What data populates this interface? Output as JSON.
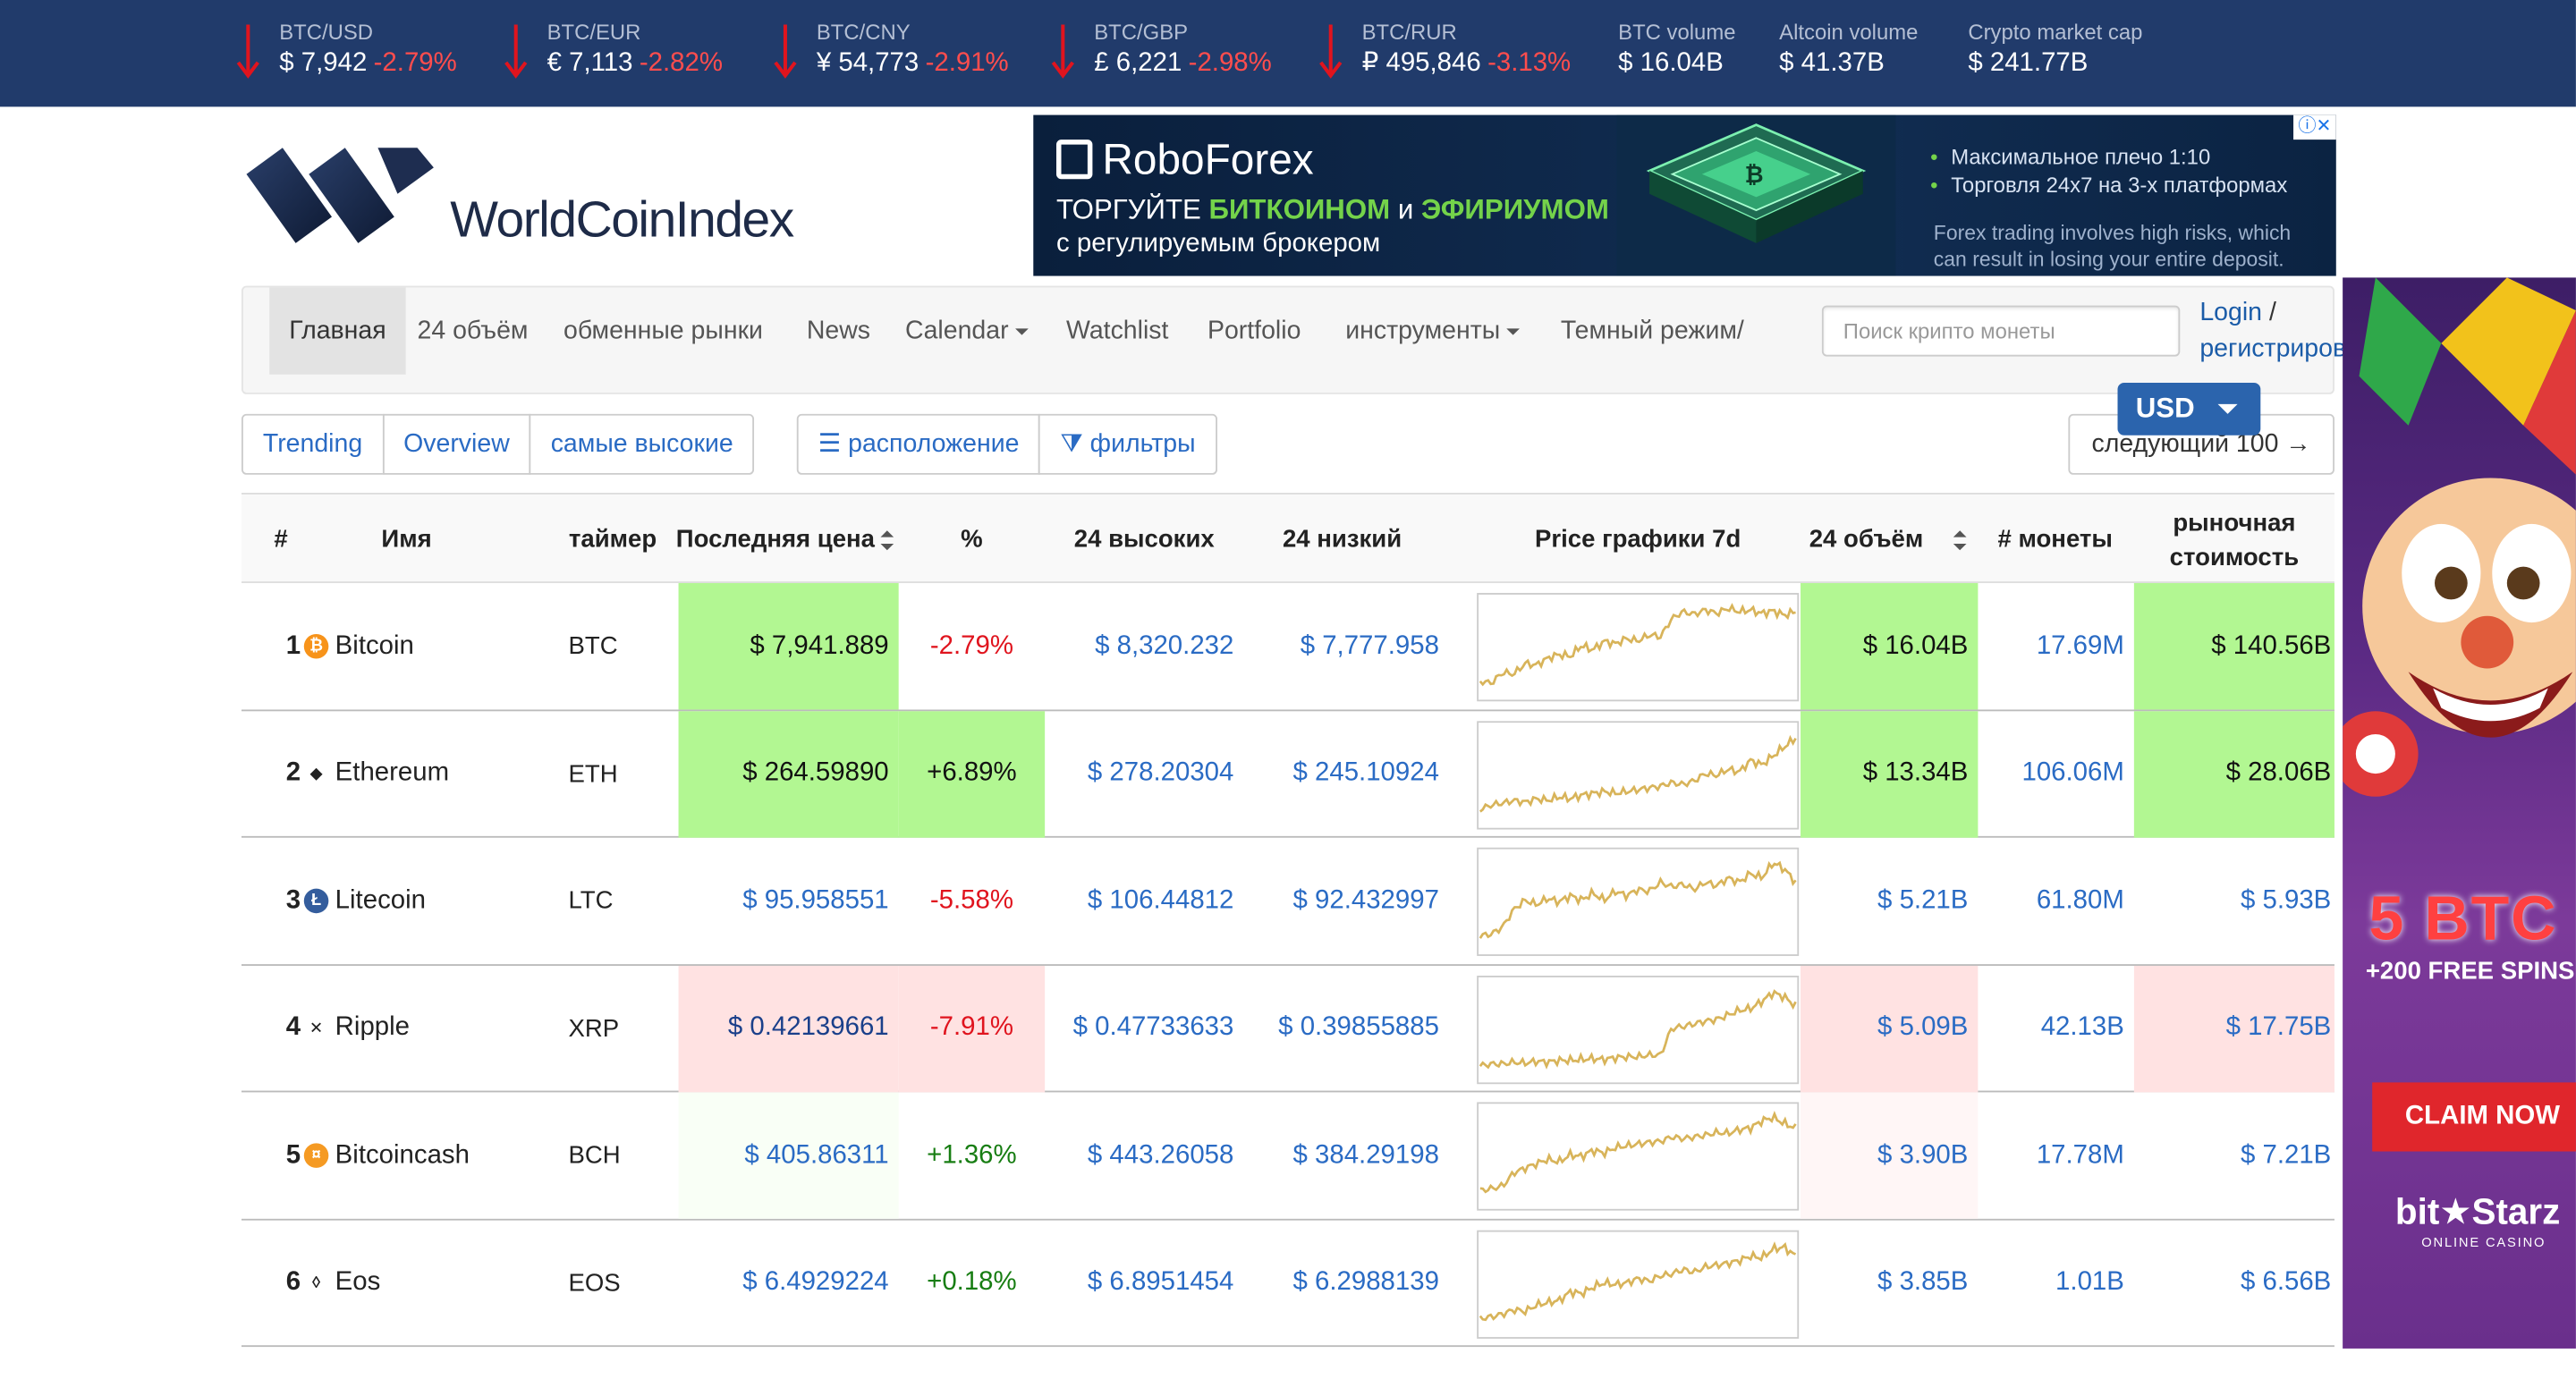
{
  "ticker": [
    {
      "label": "BTC/USD",
      "value": "$ 7,942",
      "change": "-2.79%",
      "arrow": true
    },
    {
      "label": "BTC/EUR",
      "value": "€ 7,113",
      "change": "-2.82%",
      "arrow": true
    },
    {
      "label": "BTC/CNY",
      "value": "¥ 54,773",
      "change": "-2.91%",
      "arrow": true
    },
    {
      "label": "BTC/GBP",
      "value": "£ 6,221",
      "change": "-2.98%",
      "arrow": true
    },
    {
      "label": "BTC/RUR",
      "value": "₽ 495,846",
      "change": "-3.13%",
      "arrow": true
    },
    {
      "label": "BTC volume",
      "value": "$ 16.04B",
      "change": "",
      "arrow": false
    },
    {
      "label": "Altcoin volume",
      "value": "$ 41.37B",
      "change": "",
      "arrow": false
    },
    {
      "label": "Crypto market cap",
      "value": "$ 241.77B",
      "change": "",
      "arrow": false
    }
  ],
  "logo": {
    "text": "WorldCoinIndex"
  },
  "top_ad": {
    "brand": "RoboForex",
    "line2_pre": "ТОРГУЙТЕ ",
    "line2_b1": "БИТКОИНОМ",
    "line2_mid": " и ",
    "line2_b2": "ЭФИРИУМОМ",
    "line3": "с регулируемым брокером",
    "bullet1": "Максимальное плечо 1:10",
    "bullet2": "Торговля 24x7 на 3-х платформах",
    "disclaimer1": "Forex trading involves high risks, which",
    "disclaimer2": "can result in losing your entire deposit."
  },
  "nav": {
    "items": [
      "Главная",
      "24 объём",
      "обменные рынки",
      "News",
      "Calendar",
      "Watchlist",
      "Portfolio",
      "инструменты",
      "Темный режим/"
    ],
    "search_placeholder": "Поиск крипто монеты",
    "login": "Login",
    "slash": "/",
    "register": "регистрировать"
  },
  "currency": "USD",
  "tabs": {
    "trending": "Trending",
    "overview": "Overview",
    "highest": "самые высокие"
  },
  "tools": {
    "layout": "расположение",
    "filters": "фильтры"
  },
  "next_button": "следующий 100 →",
  "table": {
    "headers": {
      "rank": "#",
      "name": "Имя",
      "ticker": "таймер",
      "price": "Последняя цена",
      "pct": "%",
      "high": "24 высоких",
      "low": "24 низкий",
      "chart": "Price графики 7d",
      "volume": "24 объём",
      "coins": "# монеты",
      "mcap1": "рыночная",
      "mcap2": "стоимость"
    },
    "rows": [
      {
        "rank": "1",
        "name": "Bitcoin",
        "ticker": "BTC",
        "price": "$ 7,941.889",
        "pct": "-2.79%",
        "high": "$ 8,320.232",
        "low": "$ 7,777.958",
        "volume": "$ 16.04B",
        "coins": "17.69M",
        "mcap": "$ 140.56B",
        "dir": "down",
        "hl": "green",
        "series": [
          0.9,
          0.92,
          0.8,
          0.82,
          0.7,
          0.72,
          0.64,
          0.6,
          0.62,
          0.5,
          0.55,
          0.45,
          0.48,
          0.42,
          0.45,
          0.38,
          0.4,
          0.2,
          0.12,
          0.15,
          0.1,
          0.14,
          0.08,
          0.12,
          0.1,
          0.14,
          0.11,
          0.16,
          0.12
        ]
      },
      {
        "rank": "2",
        "name": "Ethereum",
        "ticker": "ETH",
        "price": "$ 264.59890",
        "pct": "+6.89%",
        "high": "$ 278.20304",
        "low": "$ 245.10924",
        "volume": "$ 13.34B",
        "coins": "106.06M",
        "mcap": "$ 28.06B",
        "dir": "up",
        "hl": "green",
        "series": [
          0.9,
          0.85,
          0.83,
          0.8,
          0.82,
          0.78,
          0.8,
          0.76,
          0.78,
          0.74,
          0.72,
          0.7,
          0.72,
          0.7,
          0.68,
          0.66,
          0.64,
          0.6,
          0.62,
          0.58,
          0.5,
          0.52,
          0.45,
          0.48,
          0.35,
          0.4,
          0.3,
          0.2,
          0.1
        ]
      },
      {
        "rank": "3",
        "name": "Litecoin",
        "ticker": "LTC",
        "price": "$ 95.958551",
        "pct": "-5.58%",
        "high": "$ 106.44812",
        "low": "$ 92.432997",
        "volume": "$ 5.21B",
        "coins": "61.80M",
        "mcap": "$ 5.93B",
        "dir": "down",
        "hl": "none",
        "series": [
          0.9,
          0.88,
          0.8,
          0.6,
          0.5,
          0.55,
          0.48,
          0.52,
          0.45,
          0.5,
          0.42,
          0.5,
          0.4,
          0.45,
          0.38,
          0.4,
          0.3,
          0.35,
          0.32,
          0.38,
          0.3,
          0.34,
          0.25,
          0.3,
          0.2,
          0.25,
          0.08,
          0.15,
          0.3
        ]
      },
      {
        "rank": "4",
        "name": "Ripple",
        "ticker": "XRP",
        "price": "$ 0.42139661",
        "pct": "-7.91%",
        "high": "$ 0.47733633",
        "low": "$ 0.39855885",
        "volume": "$ 5.09B",
        "coins": "42.13B",
        "mcap": "$ 17.75B",
        "dir": "down",
        "hl": "red",
        "series": [
          0.92,
          0.9,
          0.9,
          0.88,
          0.89,
          0.87,
          0.88,
          0.86,
          0.86,
          0.85,
          0.84,
          0.85,
          0.83,
          0.82,
          0.82,
          0.8,
          0.8,
          0.5,
          0.48,
          0.45,
          0.42,
          0.4,
          0.35,
          0.3,
          0.28,
          0.2,
          0.1,
          0.15,
          0.25
        ]
      },
      {
        "rank": "5",
        "name": "Bitcoincash",
        "ticker": "BCH",
        "price": "$ 405.86311",
        "pct": "+1.36%",
        "high": "$ 443.26058",
        "low": "$ 384.29198",
        "volume": "$ 3.90B",
        "coins": "17.78M",
        "mcap": "$ 7.21B",
        "dir": "up",
        "hl": "faint",
        "series": [
          0.9,
          0.88,
          0.85,
          0.7,
          0.65,
          0.6,
          0.55,
          0.58,
          0.5,
          0.52,
          0.45,
          0.48,
          0.42,
          0.4,
          0.38,
          0.36,
          0.35,
          0.3,
          0.32,
          0.3,
          0.28,
          0.25,
          0.26,
          0.22,
          0.2,
          0.12,
          0.08,
          0.15,
          0.2
        ]
      },
      {
        "rank": "6",
        "name": "Eos",
        "ticker": "EOS",
        "price": "$ 6.4929224",
        "pct": "+0.18%",
        "high": "$ 6.8951454",
        "low": "$ 6.2988139",
        "volume": "$ 3.85B",
        "coins": "1.01B",
        "mcap": "$ 6.56B",
        "dir": "up",
        "hl": "none",
        "series": [
          0.9,
          0.88,
          0.85,
          0.8,
          0.82,
          0.75,
          0.72,
          0.7,
          0.6,
          0.62,
          0.55,
          0.5,
          0.52,
          0.5,
          0.45,
          0.48,
          0.42,
          0.4,
          0.35,
          0.38,
          0.32,
          0.3,
          0.28,
          0.25,
          0.2,
          0.22,
          0.12,
          0.1,
          0.2
        ]
      }
    ]
  },
  "side_ad": {
    "offer": "5 BTC",
    "spins": "+200 FREE SPINS",
    "claim": "CLAIM NOW",
    "brand": "bit★Starz",
    "sub": "ONLINE CASINO"
  },
  "colors": {
    "ticker_bg": "#213b6b",
    "green_hl": "#b2f792",
    "red_hl": "#ffe2e2",
    "link": "#2a6bc4",
    "negative": "#e0141e",
    "positive": "#177d12",
    "spark": "#d8b45a"
  }
}
